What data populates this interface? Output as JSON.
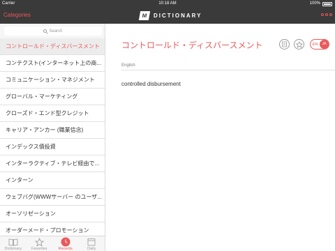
{
  "status_bar": {
    "carrier": "Carrier",
    "time": "10:18 AM",
    "battery": "100%"
  },
  "nav": {
    "categories_label": "Categories",
    "logo_mark": "M",
    "logo_text": "DICTIONARY"
  },
  "sidebar": {
    "search_placeholder": "Search",
    "items": [
      {
        "label": "コントロールド・ディスバースメント"
      },
      {
        "label": "コンテクスト(インターネット上の商..."
      },
      {
        "label": "コミュニケーション・マネジメント"
      },
      {
        "label": "グローバル・マーケティング"
      },
      {
        "label": "クローズド・エンド型クレジット"
      },
      {
        "label": "キャリア・アンカー (職業信念)"
      },
      {
        "label": "インデックス債投資"
      },
      {
        "label": "インターラクティブ・テレビ経由で..."
      },
      {
        "label": "インターン"
      },
      {
        "label": "ウェブバグ(WWWサーバー のユーザ..."
      },
      {
        "label": "オーソリゼーション"
      },
      {
        "label": "オーダーメード・プロモーション"
      }
    ],
    "selected_index": 0
  },
  "tabs": [
    {
      "label": "Dictionary",
      "icon": "book-icon"
    },
    {
      "label": "Favorites",
      "icon": "star-icon"
    },
    {
      "label": "Recents",
      "icon": "clock-icon"
    },
    {
      "label": "Daily",
      "icon": "calendar-icon"
    }
  ],
  "active_tab": "Recents",
  "entry": {
    "headword": "コントロールド・ディスバースメント",
    "section_label": "English",
    "definition": "controlled disbursement",
    "lang_from": "EN",
    "lang_to": "JA"
  },
  "colors": {
    "accent": "#e9585a",
    "bar": "#3a3a3a",
    "sidebar_bg": "#f6f6f6"
  }
}
